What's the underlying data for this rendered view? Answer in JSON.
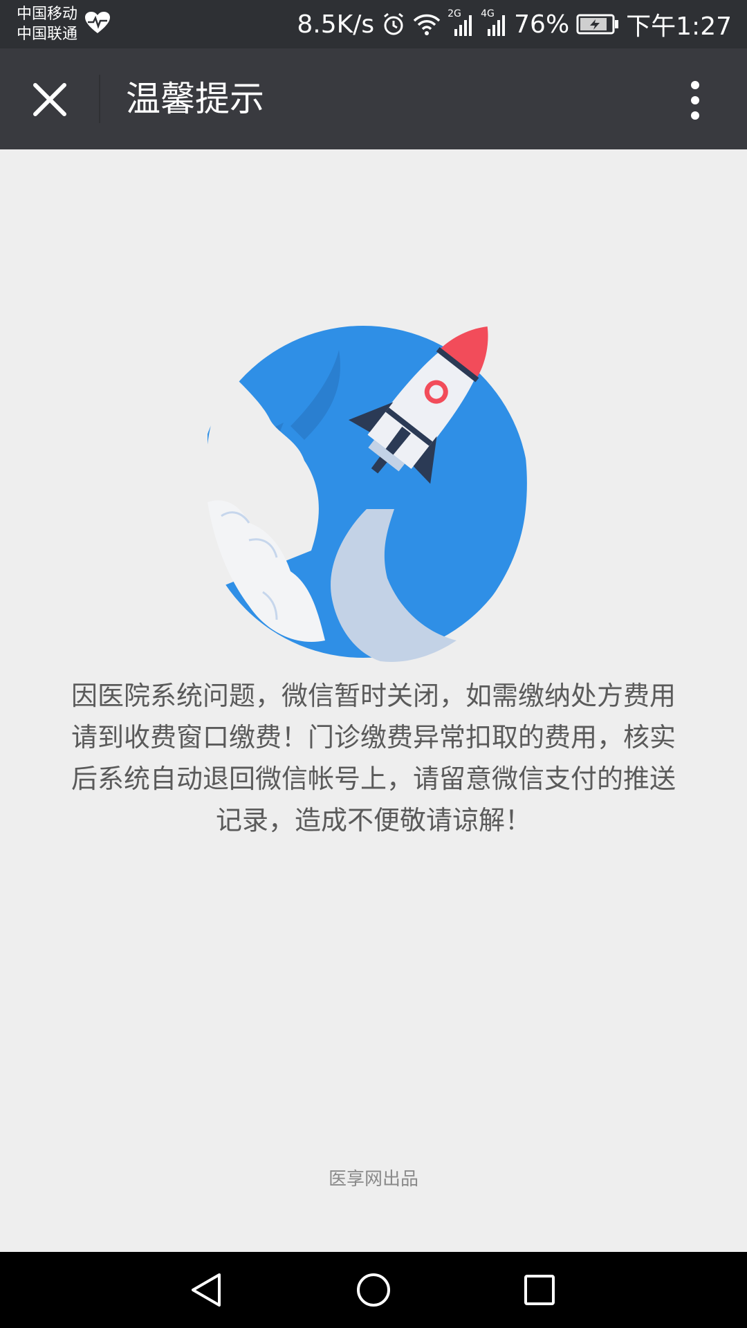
{
  "status_bar": {
    "carrier_1": "中国移动",
    "carrier_2": "中国联通",
    "net_speed": "8.5K/s",
    "sig1_label": "2G",
    "sig2_label": "4G",
    "battery": "76%",
    "time": "下午1:27"
  },
  "app_bar": {
    "title": "温馨提示"
  },
  "main": {
    "message": "因医院系统问题，微信暂时关闭，如需缴纳处方费用请到收费窗口缴费！门诊缴费异常扣取的费用，核实后系统自动退回微信帐号上，请留意微信支付的推送记录，造成不便敬请谅解！",
    "footer": "医享网出品"
  },
  "colors": {
    "status_bg": "#2e3034",
    "appbar_bg": "#393a3f",
    "content_bg": "#eeeeee",
    "planet_blue": "#2f8fe6",
    "rocket_red": "#f24c5a",
    "smoke": "#c3d2e6"
  },
  "icons": {
    "close": "close-icon",
    "more": "more-vertical-icon",
    "back": "back-triangle-icon",
    "home": "home-circle-icon",
    "recents": "recents-square-icon"
  }
}
